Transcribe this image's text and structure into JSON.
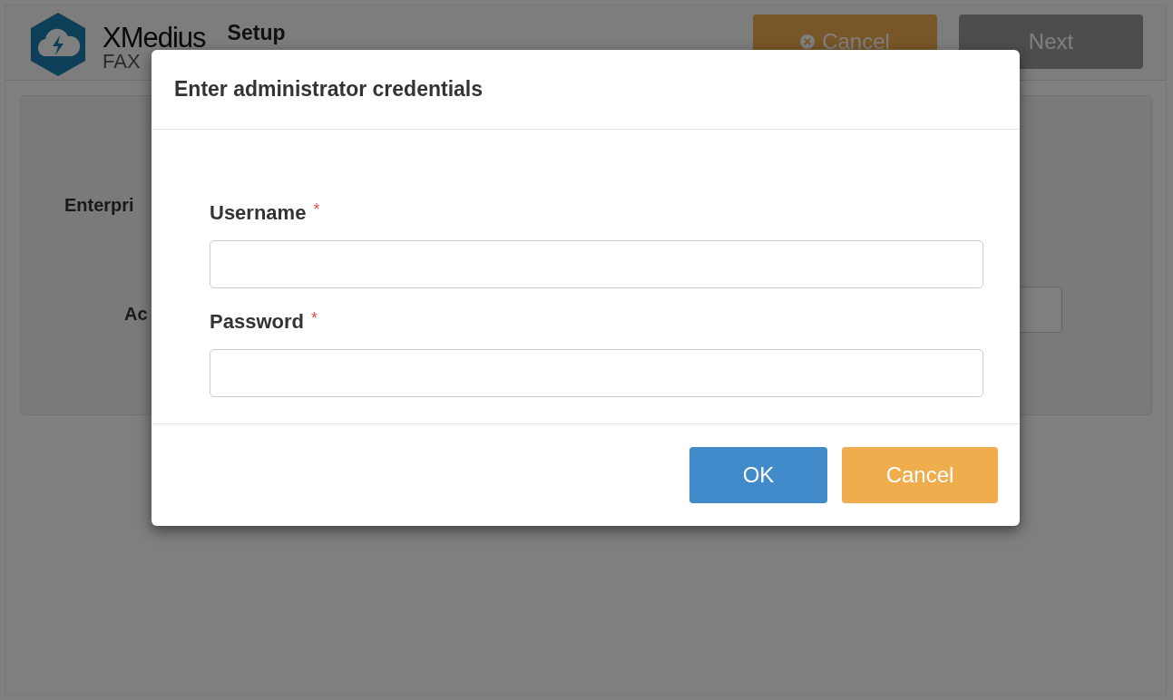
{
  "header": {
    "logo": {
      "brand": "XMedius",
      "product": "FAX"
    },
    "title": "Setup",
    "buttons": [
      {
        "kind": "cancel",
        "label": "Cancel"
      },
      {
        "kind": "next",
        "label": "Next"
      }
    ]
  },
  "form": {
    "fields": [
      {
        "label": "Enterpri"
      },
      {
        "label": "Ac"
      }
    ]
  },
  "dialog": {
    "title": "Enter administrator credentials",
    "fields": [
      {
        "label": "Username",
        "required_mark": "*"
      },
      {
        "label": "Password",
        "required_mark": "*"
      }
    ],
    "buttons": [
      {
        "kind": "primary",
        "label": "OK"
      },
      {
        "kind": "warning",
        "label": "Cancel"
      }
    ]
  }
}
